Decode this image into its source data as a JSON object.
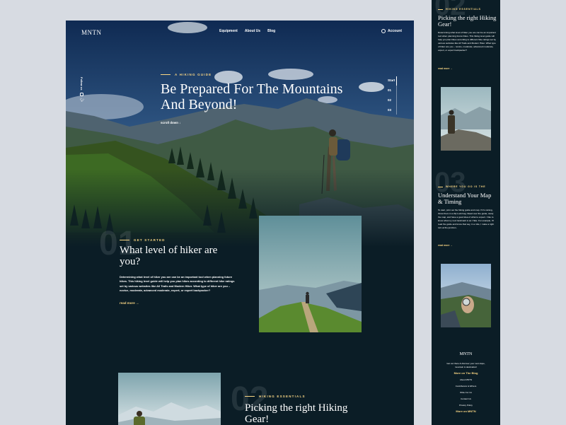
{
  "logo": "MNTN",
  "nav": [
    "Equipment",
    "About Us",
    "Blog"
  ],
  "account": "Account",
  "follow": "Follow us",
  "hero": {
    "eyebrow": "A HIKING GUIDE",
    "title": "Be Prepared For The Mountains And Beyond!",
    "scroll": "scroll down"
  },
  "slides": [
    "Start",
    "01",
    "02",
    "03"
  ],
  "section1": {
    "number": "01",
    "eyebrow": "GET STARTED",
    "title": "What level of hiker are you?",
    "body": "Determining what level of hiker you are can be an important tool when planning future hikes. This hiking level guide will help you plan hikes according to different hike ratings set by various websites like All Trails and Modern Hiker. What type of hiker are you – novice, moderate, advanced moderate, expert, or expert backpacker?",
    "read_more": "read more"
  },
  "section2": {
    "number": "02",
    "eyebrow": "HIKING ESSENTIALS",
    "title": "Picking the right Hiking Gear!"
  },
  "side": {
    "s2": {
      "number": "02",
      "eyebrow": "HIKING ESSENTIALS",
      "title": "Picking the right Hiking Gear!",
      "body": "Determining what level of hiker you are can be an important tool when planning future hikes. This hiking level guide will help you plan hikes according to different hike ratings set by various websites like All Trails and Modern Hiker. What type of hiker are you – novice, moderate, advanced moderate, expert, or expert backpacker?",
      "read_more": "read more"
    },
    "s3": {
      "number": "03",
      "eyebrow": "WHERE YOU GO IS THE",
      "title": "Understand Your Map & Timing",
      "body": "To start, print out the hiking guide and map. If it's raining, throw them in a Zip Lock bag. Read over the guide, study the map, and have a good idea of what to expect. I like to know what my next landmark is as I hike. For example, I'll read the guide and know that say, in a mile, I make a right turn at the junction..",
      "read_more": "read more"
    },
    "footer": {
      "logo": "MNTN",
      "desc": "Get out there & discover your next slope, mountain & destination!",
      "blog_heading": "More on The Blog",
      "links": [
        "About MNTN",
        "Contributors & Writers",
        "Write For Us",
        "Contact Us",
        "Privacy Policy"
      ],
      "more_heading": "More on MNTN"
    }
  },
  "colors": {
    "accent": "#fbd784",
    "background": "#0b1d26",
    "page": "#d7dbe2"
  }
}
